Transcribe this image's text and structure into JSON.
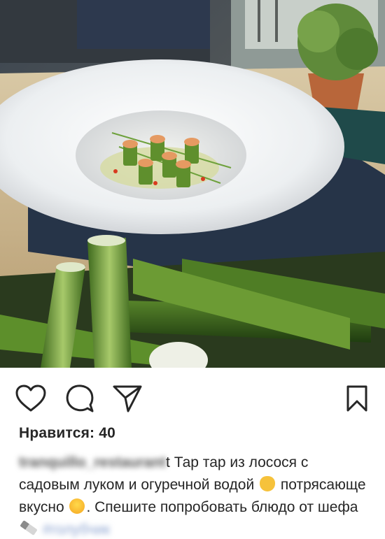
{
  "post": {
    "likes_label": "Нравится:",
    "likes_count": "40",
    "username": "tranquillo_restaurant",
    "username_tail": "t",
    "caption_text_1": "Тар тар из лосося с садовым луком и огуречной водой",
    "caption_text_2": "потрясающе вкусно",
    "caption_text_3": ". Спешите попробовать блюдо от шефа",
    "hashtag": "#голубчик"
  },
  "icons": {
    "like": "heart-icon",
    "comment": "comment-bubble-icon",
    "share": "paper-plane-icon",
    "save": "bookmark-icon",
    "emoji_1": "ok-hand-emoji",
    "emoji_2": "yum-face-emoji",
    "emoji_3": "knife-emoji"
  },
  "colors": {
    "text": "#262626",
    "background": "#ffffff",
    "hashtag": "#8aa2d0"
  }
}
